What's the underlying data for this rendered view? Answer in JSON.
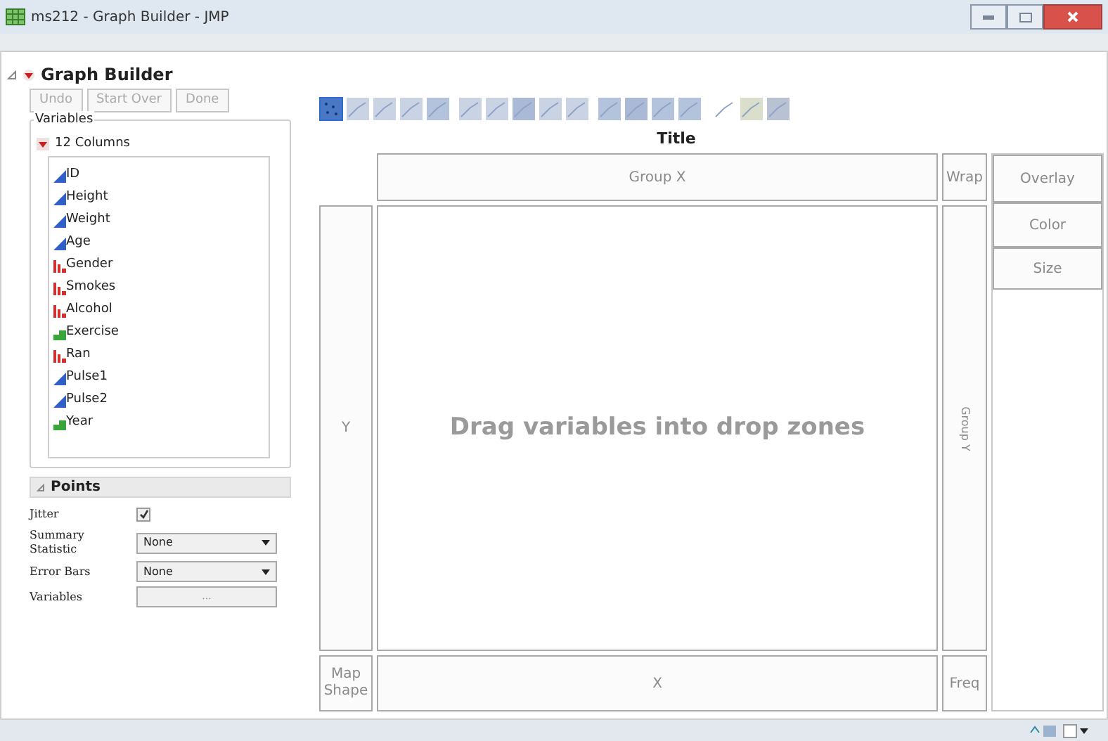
{
  "window": {
    "title": "ms212 - Graph Builder - JMP"
  },
  "header": {
    "title": "Graph Builder"
  },
  "buttons": [
    {
      "label": "Undo",
      "disabled": true
    },
    {
      "label": "Start Over",
      "disabled": true
    },
    {
      "label": "Done",
      "disabled": true
    }
  ],
  "variables": {
    "legend": "Variables",
    "group": "12 Columns",
    "columns": [
      {
        "name": "ID",
        "kind": "continuous"
      },
      {
        "name": "Height",
        "kind": "continuous"
      },
      {
        "name": "Weight",
        "kind": "continuous"
      },
      {
        "name": "Age",
        "kind": "continuous"
      },
      {
        "name": "Gender",
        "kind": "nominal"
      },
      {
        "name": "Smokes",
        "kind": "nominal"
      },
      {
        "name": "Alcohol",
        "kind": "nominal"
      },
      {
        "name": "Exercise",
        "kind": "ordinal"
      },
      {
        "name": "Ran",
        "kind": "nominal"
      },
      {
        "name": "Pulse1",
        "kind": "continuous"
      },
      {
        "name": "Pulse2",
        "kind": "continuous"
      },
      {
        "name": "Year",
        "kind": "ordinal"
      }
    ]
  },
  "points": {
    "title": "Points",
    "rows": [
      {
        "kind": "checkbox",
        "label": "Jitter",
        "checked": true
      },
      {
        "kind": "dropdown",
        "label": "Summary Statistic",
        "value": "None"
      },
      {
        "kind": "dropdown",
        "label": "Error Bars",
        "value": "None"
      },
      {
        "kind": "button",
        "label": "Variables",
        "value": "..."
      }
    ]
  },
  "graph": {
    "title": "Title",
    "group_x": "Group X",
    "wrap": "Wrap",
    "overlay": "Overlay",
    "color_zone": "Color",
    "size": "Size",
    "y": "Y",
    "placeholder": "Drag variables into drop zones",
    "group_y": "Group Y",
    "map_shape": "Map Shape",
    "x": "X",
    "freq": "Freq"
  }
}
